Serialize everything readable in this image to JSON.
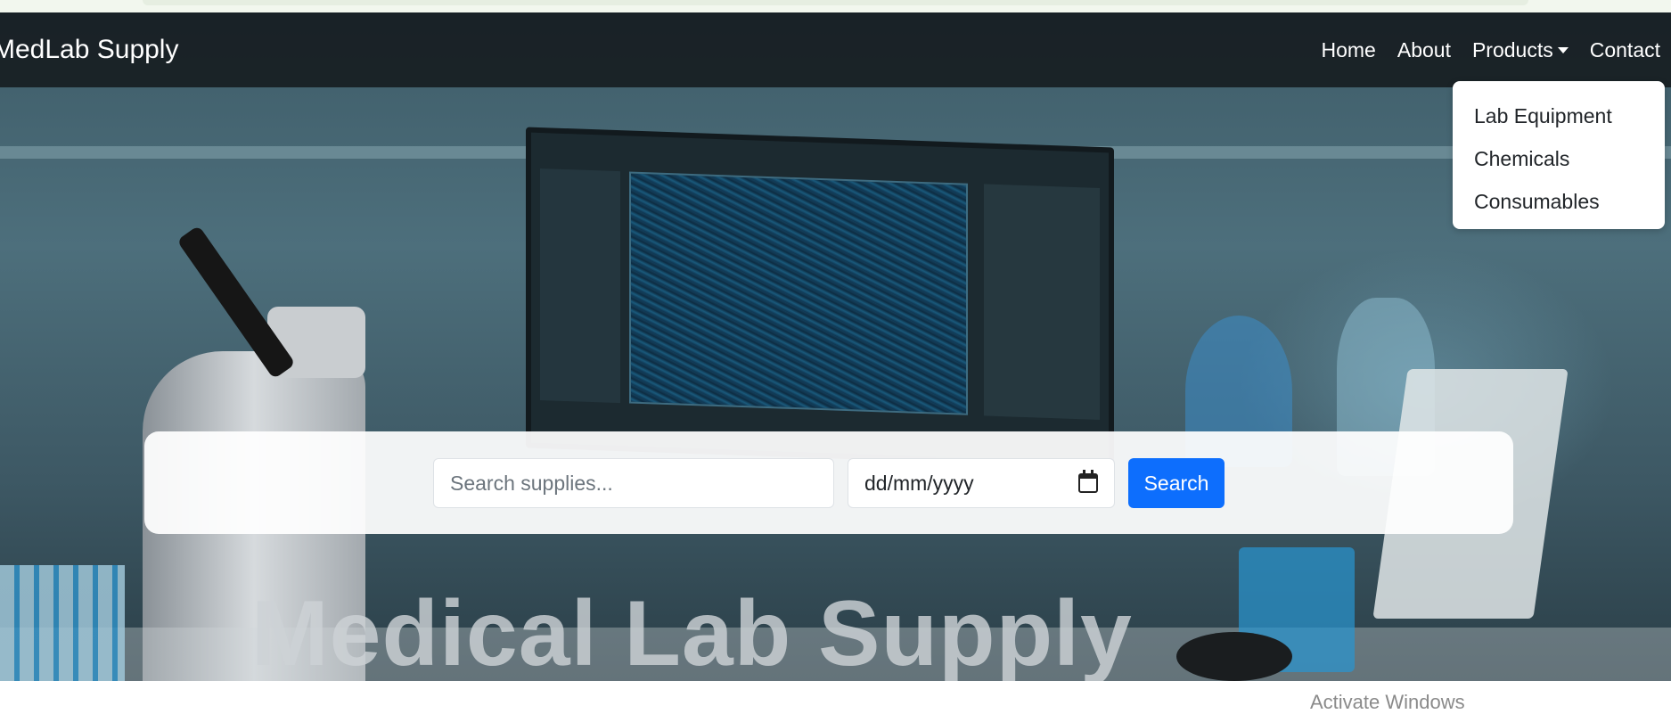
{
  "navbar": {
    "brand": "MedLab Supply",
    "links": [
      {
        "label": "Home"
      },
      {
        "label": "About"
      },
      {
        "label": "Products"
      },
      {
        "label": "Contact"
      }
    ]
  },
  "products_dropdown": {
    "items": [
      {
        "label": "Lab Equipment"
      },
      {
        "label": "Chemicals"
      },
      {
        "label": "Consumables"
      }
    ]
  },
  "search": {
    "placeholder": "Search supplies...",
    "value": "",
    "date_placeholder": "dd/mm/yyyy",
    "button_label": "Search"
  },
  "hero": {
    "title": "Medical Lab Supply"
  },
  "system": {
    "watermark": "Activate Windows"
  },
  "colors": {
    "accent": "#0d6efd",
    "navbar_bg": "#141a1e"
  }
}
